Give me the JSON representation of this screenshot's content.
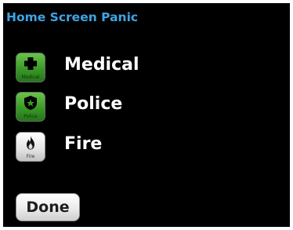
{
  "screen": {
    "title": "Home Screen Panic",
    "title_color": "#3fa4e6",
    "background": "#000000"
  },
  "panic_options": [
    {
      "label": "Medical",
      "icon": "medical-cross-icon",
      "icon_caption": "Medical",
      "icon_color": "#389a26"
    },
    {
      "label": "Police",
      "icon": "police-badge-icon",
      "icon_caption": "Police",
      "icon_color": "#389a26"
    },
    {
      "label": "Fire",
      "icon": "fire-flame-icon",
      "icon_caption": "Fire",
      "icon_color": "#e2e2e2"
    }
  ],
  "footer": {
    "done_label": "Done"
  }
}
